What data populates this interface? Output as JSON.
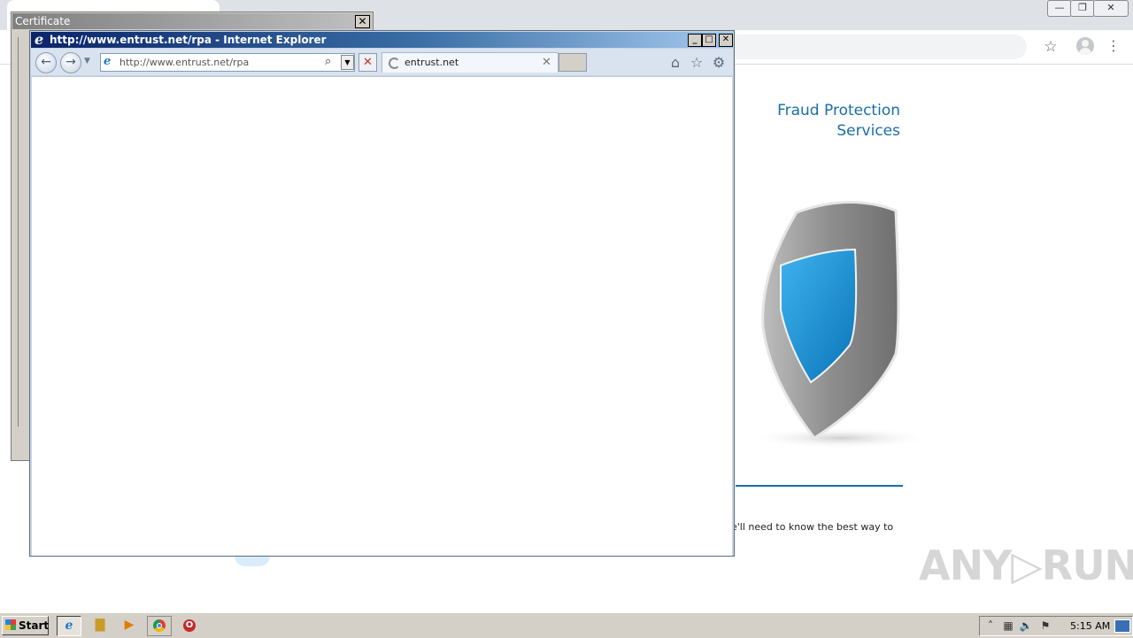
{
  "chrome": {
    "window_min": "—",
    "window_max": "❐",
    "window_close": "✕",
    "star_icon": "☆",
    "menu_icon": "⋮",
    "page": {
      "title_line1": "Fraud Protection",
      "title_line2": "Services",
      "body_fragment": "e'll need to know the best way to",
      "accent_color": "#1a6ea8"
    }
  },
  "certificate_dialog": {
    "title": "Certificate",
    "close_label": "✕"
  },
  "ie": {
    "title": "http://www.entrust.net/rpa - Internet Explorer",
    "logo_glyph": "e",
    "min_label": "_",
    "max_label": "□",
    "close_label": "✕",
    "back_glyph": "←",
    "forward_glyph": "→",
    "address": "http://www.entrust.net/rpa",
    "search_glyph": "⌕",
    "addr_dropdown_glyph": "▼",
    "stop_glyph": "✕",
    "tab_label": "entrust.net",
    "tab_close": "✕",
    "home_glyph": "⌂",
    "fav_glyph": "☆",
    "gear_glyph": "⚙"
  },
  "watermark": "ANY▷RUN",
  "taskbar": {
    "start_label": "Start",
    "ie_glyph": "e",
    "explorer_glyph": "▇",
    "media_glyph": "▶",
    "opera_glyph": "O",
    "tray": {
      "up_glyph": "˄",
      "net_glyph": "▦",
      "vol_glyph": "🔈",
      "flag_glyph": "⚑",
      "clock": "5:15 AM"
    }
  }
}
